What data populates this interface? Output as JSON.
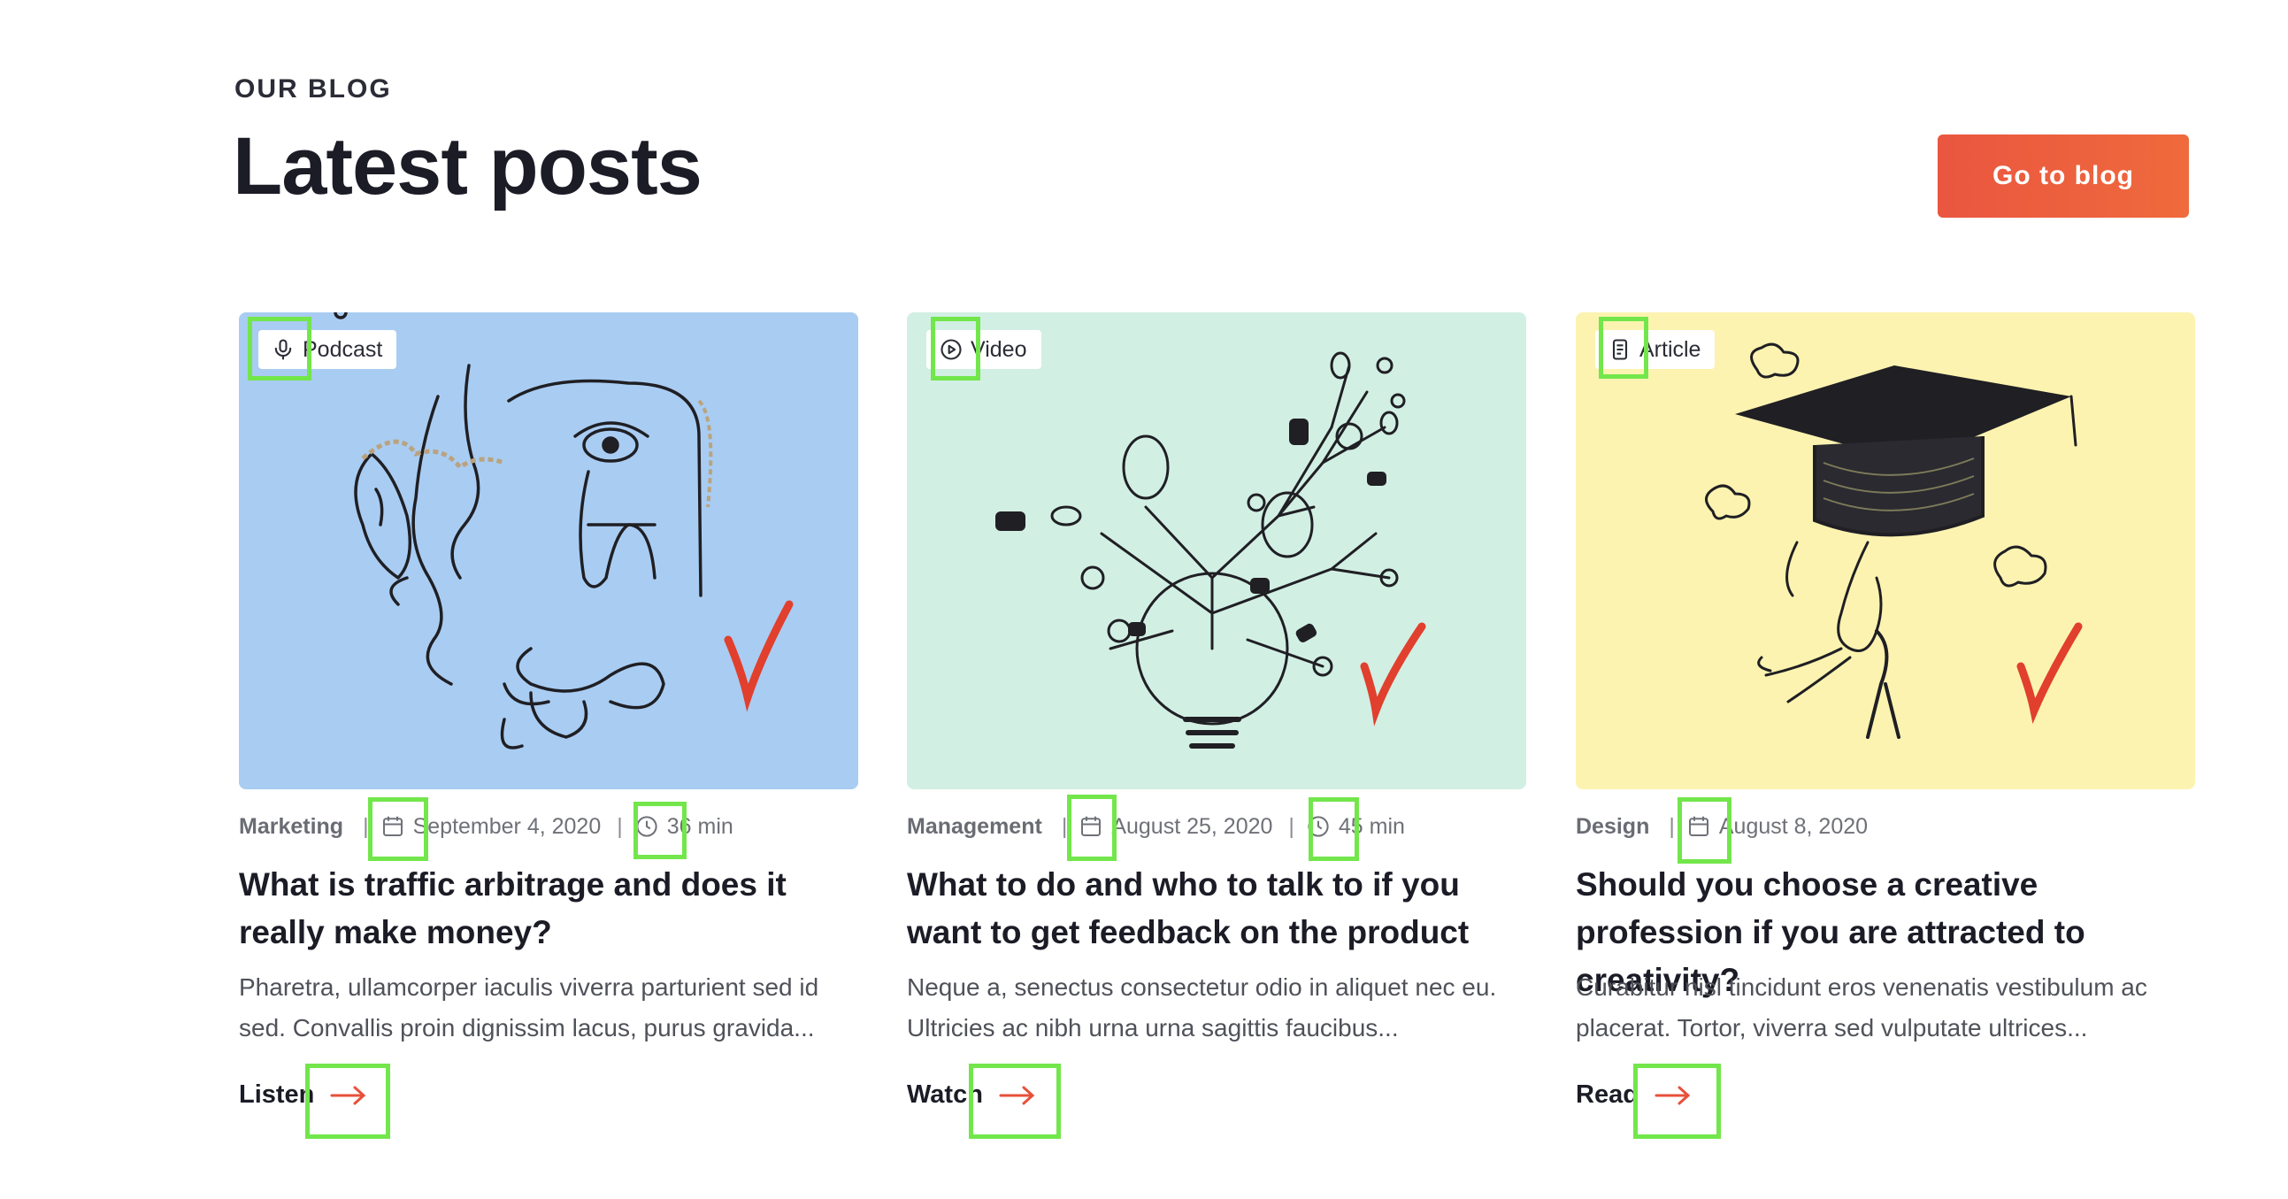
{
  "header": {
    "eyebrow": "OUR BLOG",
    "title": "Latest posts",
    "cta_label": "Go to blog"
  },
  "colors": {
    "accent": "#ec5b3f",
    "title": "#1b1c26",
    "muted": "#6f7178",
    "highlight": "#72e64b"
  },
  "posts": [
    {
      "type_label": "Podcast",
      "type_icon": "microphone-icon",
      "image_bg": "#a9ccf2",
      "category": "Marketing",
      "date": "September 4, 2020",
      "duration": "36 min",
      "title": "What is traffic arbitrage and does it really make money?",
      "excerpt": "Pharetra, ullamcorper iaculis viverra parturient sed id sed. Convallis proin dignissim lacus, purus gravida...",
      "action_label": "Listen"
    },
    {
      "type_label": "Video",
      "type_icon": "play-circle-icon",
      "image_bg": "#d2efe3",
      "category": "Management",
      "date": "August 25, 2020",
      "duration": "45 min",
      "title": "What to do and who to talk to if you want to get feedback on the product",
      "excerpt": "Neque a, senectus consectetur odio in aliquet nec eu. Ultricies ac nibh urna urna sagittis faucibus...",
      "action_label": "Watch"
    },
    {
      "type_label": "Article",
      "type_icon": "document-icon",
      "image_bg": "#fdf3b0",
      "category": "Design",
      "date": "August 8, 2020",
      "duration": "",
      "title": "Should you choose a creative profession if you are attracted to creativity?",
      "excerpt": "Curabitur nisl tincidunt eros venenatis vestibulum ac placerat. Tortor, viverra sed vulputate ultrices...",
      "action_label": "Read"
    }
  ]
}
